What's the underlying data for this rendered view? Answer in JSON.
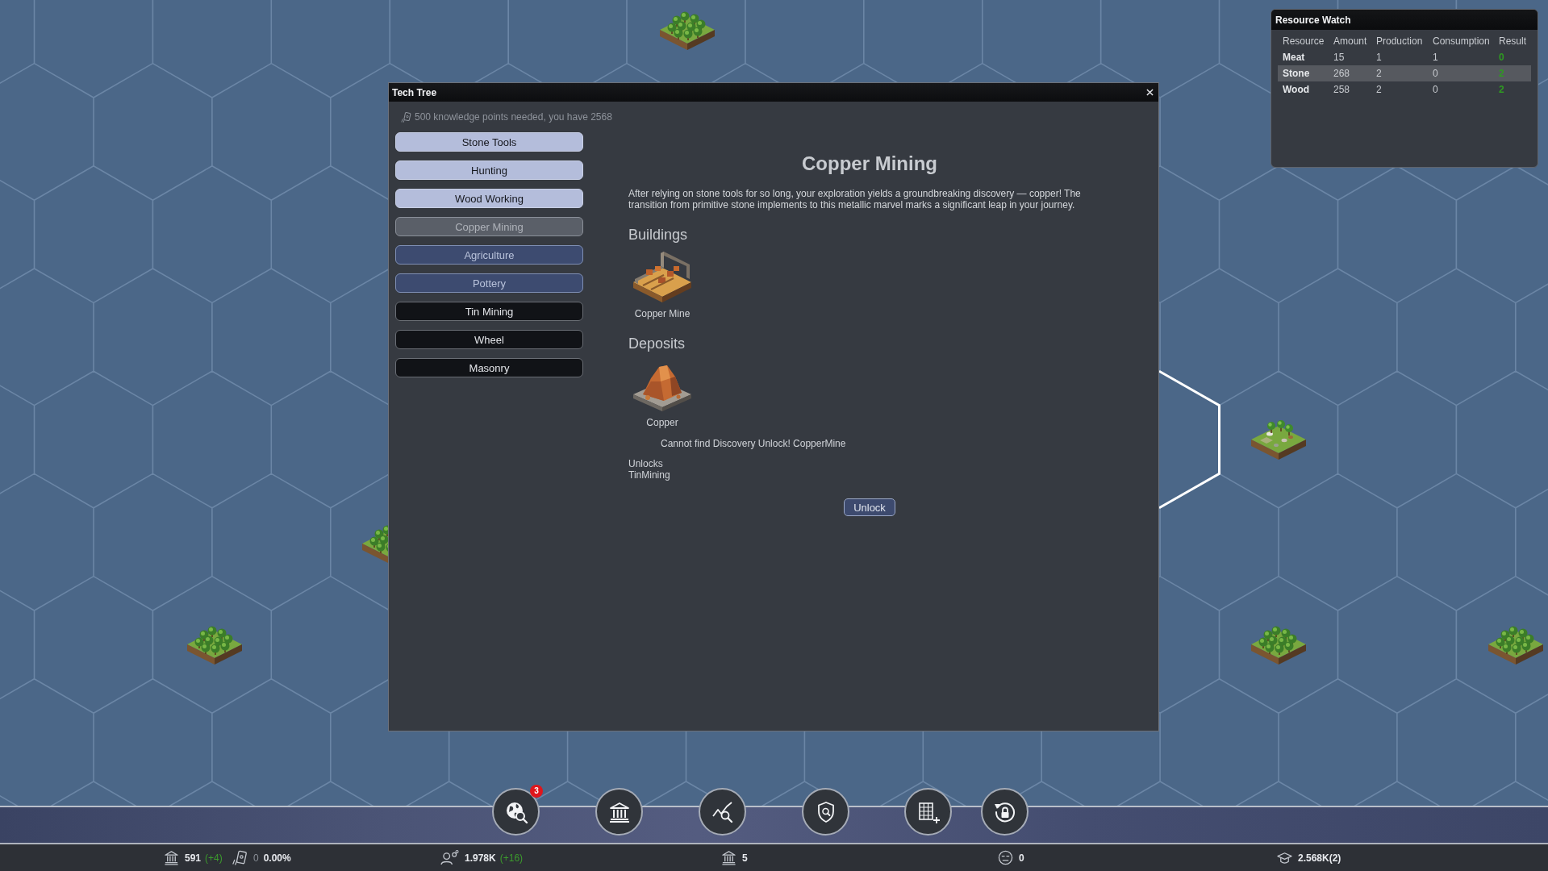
{
  "resource_watch": {
    "title": "Resource Watch",
    "columns": [
      "Resource",
      "Amount",
      "Production",
      "Consumption",
      "Result"
    ],
    "rows": [
      {
        "cells": [
          "Meat",
          "15",
          "1",
          "1",
          "0"
        ],
        "selected": false
      },
      {
        "cells": [
          "Stone",
          "268",
          "2",
          "0",
          "2"
        ],
        "selected": true
      },
      {
        "cells": [
          "Wood",
          "258",
          "2",
          "0",
          "2"
        ],
        "selected": false
      }
    ]
  },
  "tech_tree": {
    "title": "Tech Tree",
    "knowledge_note": "500 knowledge points needed, you have 2568",
    "techs": [
      {
        "label": "Stone Tools",
        "kind": "researched",
        "selected": false
      },
      {
        "label": "Hunting",
        "kind": "researched",
        "selected": false
      },
      {
        "label": "Wood Working",
        "kind": "researched",
        "selected": false
      },
      {
        "label": "Copper Mining",
        "kind": "available",
        "selected": true
      },
      {
        "label": "Agriculture",
        "kind": "available",
        "selected": false
      },
      {
        "label": "Pottery",
        "kind": "available",
        "selected": false
      },
      {
        "label": "Tin Mining",
        "kind": "locked",
        "selected": false
      },
      {
        "label": "Wheel",
        "kind": "locked",
        "selected": false
      },
      {
        "label": "Masonry",
        "kind": "locked",
        "selected": false
      }
    ],
    "detail": {
      "title": "Copper Mining",
      "description": "After relying on stone tools for so long, your exploration yields a groundbreaking discovery — copper! The transition from primitive stone implements to this metallic marvel marks a significant leap in your journey.",
      "buildings_heading": "Buildings",
      "buildings": [
        {
          "name": "Copper Mine",
          "kind": "mine"
        }
      ],
      "deposits_heading": "Deposits",
      "deposits": [
        {
          "name": "Copper",
          "kind": "ore"
        }
      ],
      "error": "Cannot find Discovery Unlock! CopperMine",
      "unlocks_label": "Unlocks",
      "unlocks": [
        "TinMining"
      ],
      "unlock_button": "Unlock"
    }
  },
  "toolbar": {
    "buttons": [
      {
        "kind": "globe",
        "badge": "3"
      },
      {
        "kind": "bank"
      },
      {
        "kind": "chart"
      },
      {
        "kind": "shield"
      },
      {
        "kind": "grid"
      },
      {
        "kind": "lock"
      }
    ]
  },
  "status_bar": {
    "items": [
      {
        "kind": "bank",
        "value": "591",
        "delta": "(+4)"
      },
      {
        "kind": "phone",
        "count": "0",
        "value": "0.00%"
      },
      {
        "kind": "person",
        "value": "1.978K",
        "delta": "(+16)"
      },
      {
        "kind": "bank",
        "value": "5"
      },
      {
        "kind": "face",
        "value": "0"
      },
      {
        "kind": "mortarboard",
        "value": "2.568K(2)"
      }
    ]
  }
}
